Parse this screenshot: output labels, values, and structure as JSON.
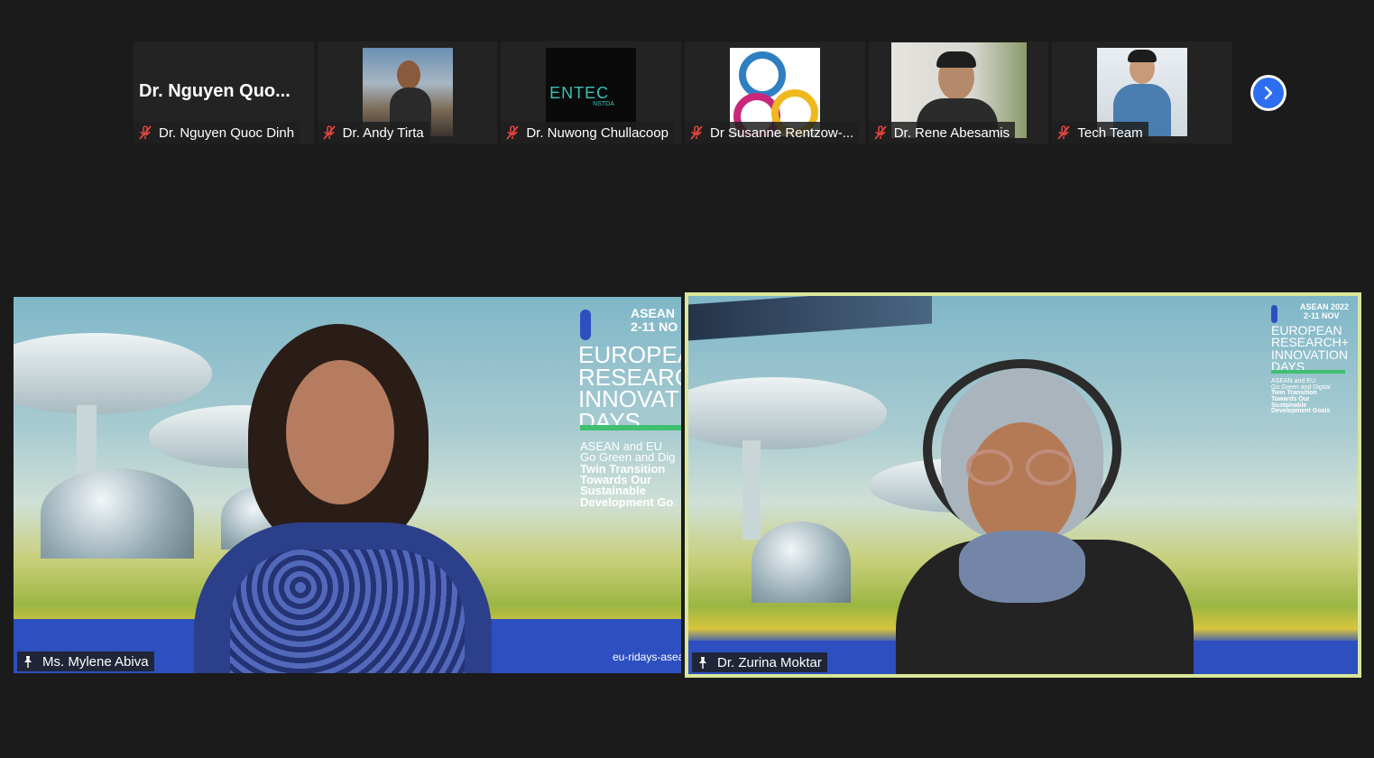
{
  "gallery": {
    "tiles": [
      {
        "big_name": "Dr. Nguyen Quo...",
        "label": "Dr. Nguyen Quoc Dinh"
      },
      {
        "label": "Dr. Andy Tirta"
      },
      {
        "label": "Dr. Nuwong Chullacoop",
        "logo_text": "ENTEC",
        "logo_sub": "NSTDA"
      },
      {
        "label": "Dr Susanne Rentzow-..."
      },
      {
        "label": "Dr. Rene Abesamis"
      },
      {
        "label": "Tech Team"
      }
    ],
    "next_icon": "chevron-right-icon"
  },
  "speakers": {
    "left": {
      "name": "Ms. Mylene Abiva",
      "poster": {
        "event_top": "ASEAN",
        "dates": "2-11 NO",
        "title_lines": [
          "EUROPEA",
          "RESEARC",
          "INNOVATIO",
          "DAYS"
        ],
        "sub_lines": [
          "ASEAN and EU",
          "Go Green and Dig"
        ],
        "bold_lines": [
          "Twin Transition",
          "Towards Our",
          "Sustainable",
          "Development Go"
        ],
        "url": "eu-ridays-asea"
      }
    },
    "right": {
      "name": "Dr. Zurina Moktar",
      "poster": {
        "event_top": "ASEAN 2022",
        "dates": "2-11 NOV",
        "title_lines": [
          "EUROPEAN",
          "RESEARCH+",
          "INNOVATION",
          "DAYS"
        ],
        "sub_lines": [
          "ASEAN and EU",
          "Go Green and Digital"
        ],
        "bold_lines": [
          "Twin Transition",
          "Towards Our",
          "Sustainable",
          "Development Goals"
        ]
      }
    }
  },
  "colors": {
    "active_speaker_border": "#d9e79a",
    "next_button": "#2d6ef0",
    "mute": "#e0443c"
  }
}
